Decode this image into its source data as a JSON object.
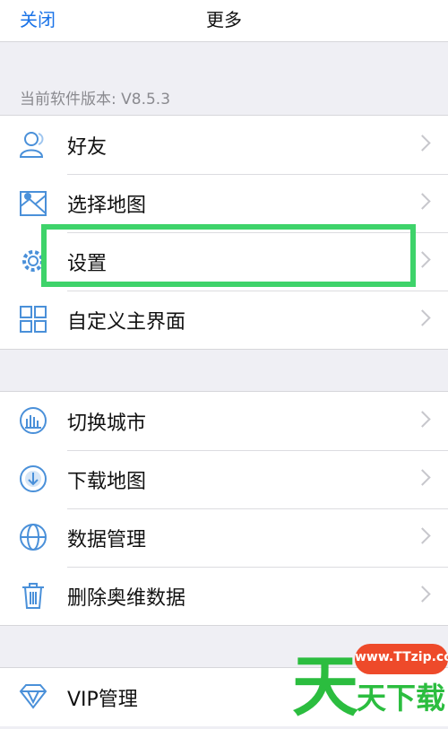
{
  "nav": {
    "close_label": "关闭",
    "title": "更多"
  },
  "version_text": "当前软件版本: V8.5.3",
  "group1": {
    "items": [
      {
        "label": "好友",
        "icon": "friends-icon"
      },
      {
        "label": "选择地图",
        "icon": "map-select-icon"
      },
      {
        "label": "设置",
        "icon": "gear-icon"
      },
      {
        "label": "自定义主界面",
        "icon": "grid-icon"
      }
    ]
  },
  "group2": {
    "items": [
      {
        "label": "切换城市",
        "icon": "city-icon"
      },
      {
        "label": "下载地图",
        "icon": "download-icon"
      },
      {
        "label": "数据管理",
        "icon": "globe-icon"
      },
      {
        "label": "删除奥维数据",
        "icon": "trash-icon"
      }
    ]
  },
  "group3": {
    "items": [
      {
        "label": "VIP管理",
        "icon": "diamond-icon"
      }
    ]
  },
  "watermark": {
    "url": "www.TTzip.com",
    "big_char": "天",
    "small_text": "天下载"
  },
  "colors": {
    "accent": "#1a73e8",
    "highlight": "#3ed36a",
    "background": "#efeff4",
    "watermark_green": "#2bbd3f",
    "watermark_red": "#ee4a2a"
  }
}
